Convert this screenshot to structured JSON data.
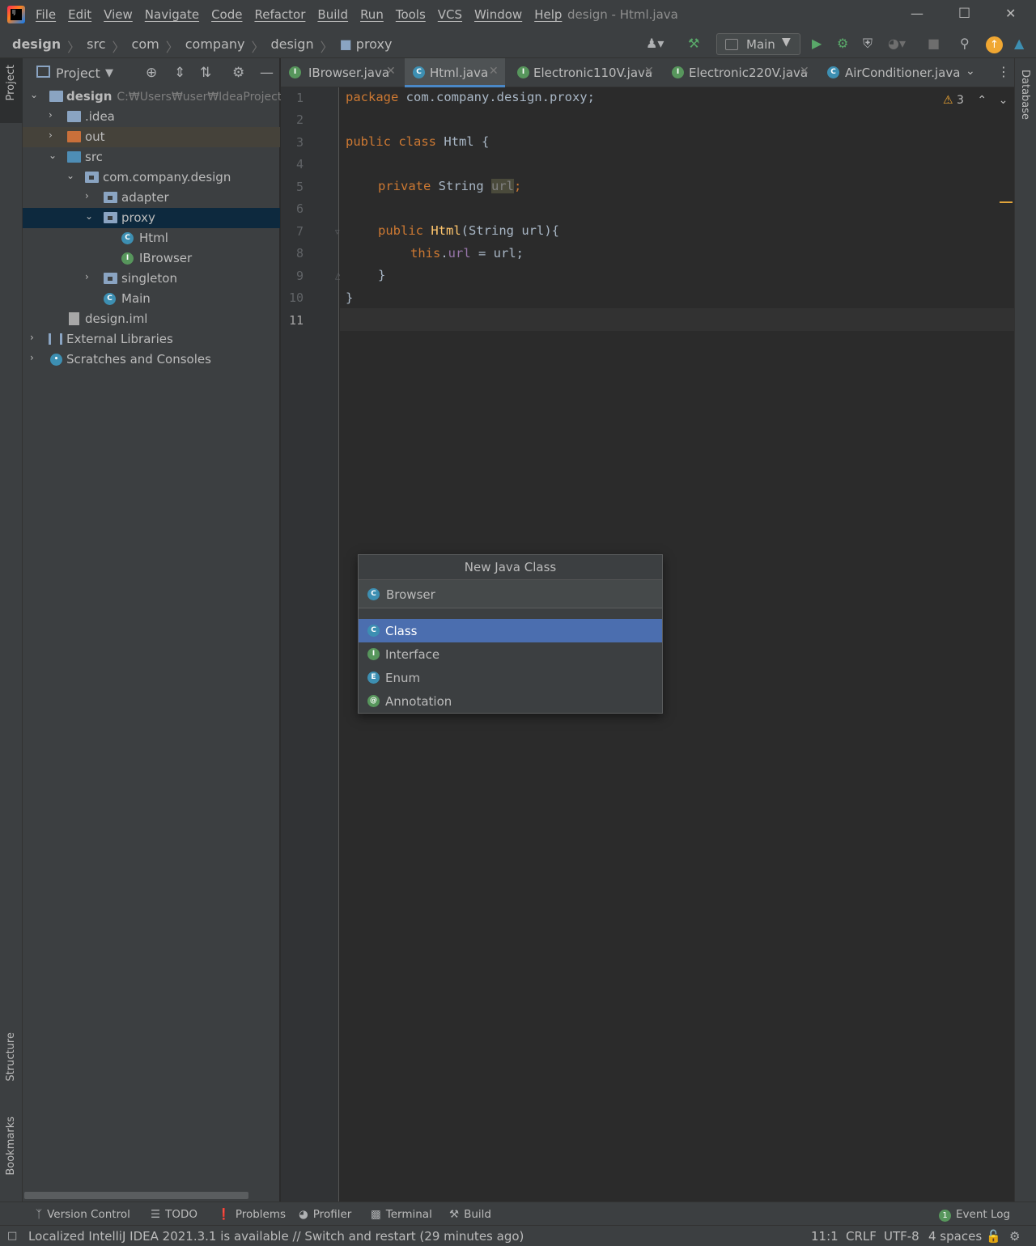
{
  "menubar": {
    "items": [
      "File",
      "Edit",
      "View",
      "Navigate",
      "Code",
      "Refactor",
      "Build",
      "Run",
      "Tools",
      "VCS",
      "Window",
      "Help"
    ],
    "title": "design - Html.java"
  },
  "navbar": {
    "breadcrumbs": [
      "design",
      "src",
      "com",
      "company",
      "design",
      "proxy"
    ],
    "run_config": "Main"
  },
  "left_stripe": {
    "project": "Project",
    "structure": "Structure",
    "bookmarks": "Bookmarks"
  },
  "right_stripe": {
    "database": "Database"
  },
  "project_panel": {
    "title": "Project",
    "tree": [
      {
        "label": "design",
        "path": "C:₩Users₩user₩IdeaProjects₩d"
      },
      {
        "label": ".idea"
      },
      {
        "label": "out"
      },
      {
        "label": "src"
      },
      {
        "label": "com.company.design"
      },
      {
        "label": "adapter"
      },
      {
        "label": "proxy"
      },
      {
        "label": "Html"
      },
      {
        "label": "IBrowser"
      },
      {
        "label": "singleton"
      },
      {
        "label": "Main"
      },
      {
        "label": "design.iml"
      },
      {
        "label": "External Libraries"
      },
      {
        "label": "Scratches and Consoles"
      }
    ]
  },
  "tabs": [
    {
      "label": "IBrowser.java",
      "kind": "I"
    },
    {
      "label": "Html.java",
      "kind": "C",
      "active": true
    },
    {
      "label": "Electronic110V.java",
      "kind": "I"
    },
    {
      "label": "Electronic220V.java",
      "kind": "I"
    },
    {
      "label": "AirConditioner.java",
      "kind": "C"
    }
  ],
  "editor": {
    "line_numbers": [
      "1",
      "2",
      "3",
      "4",
      "5",
      "6",
      "7",
      "8",
      "9",
      "10",
      "11"
    ],
    "warnings_count": "3",
    "code": {
      "l1_kw": "package",
      "l1_rest": " com.company.design.proxy;",
      "l3_kw": "public class",
      "l3_rest": " Html {",
      "l5_kw": "private",
      "l5_type": " String ",
      "l5_field": "url",
      "l5_semi": ";",
      "l7_kw": "public",
      "l7_name": "Html",
      "l7_rest": "(String url){",
      "l8_this": "this",
      "l8_dot": ".",
      "l8_field": "url",
      "l8_rest": " = url;",
      "l9": "}",
      "l10": "}"
    }
  },
  "popup": {
    "title": "New Java Class",
    "input_value": "Browser",
    "options": [
      "Class",
      "Interface",
      "Enum",
      "Annotation"
    ],
    "selected": "Class"
  },
  "tool_windows": [
    "Version Control",
    "TODO",
    "Problems",
    "Profiler",
    "Terminal",
    "Build"
  ],
  "event_log": {
    "label": "Event Log",
    "count": "1"
  },
  "status": {
    "message": "Localized IntelliJ IDEA 2021.3.1 is available // Switch and restart (29 minutes ago)",
    "position": "11:1",
    "line_sep": "CRLF",
    "encoding": "UTF-8",
    "indent": "4 spaces"
  },
  "colors": {
    "accent": "#4b6eaf",
    "tab_underline": "#4a88c7",
    "keyword": "#cc7832",
    "field": "#9876aa",
    "method": "#ffc66d"
  }
}
